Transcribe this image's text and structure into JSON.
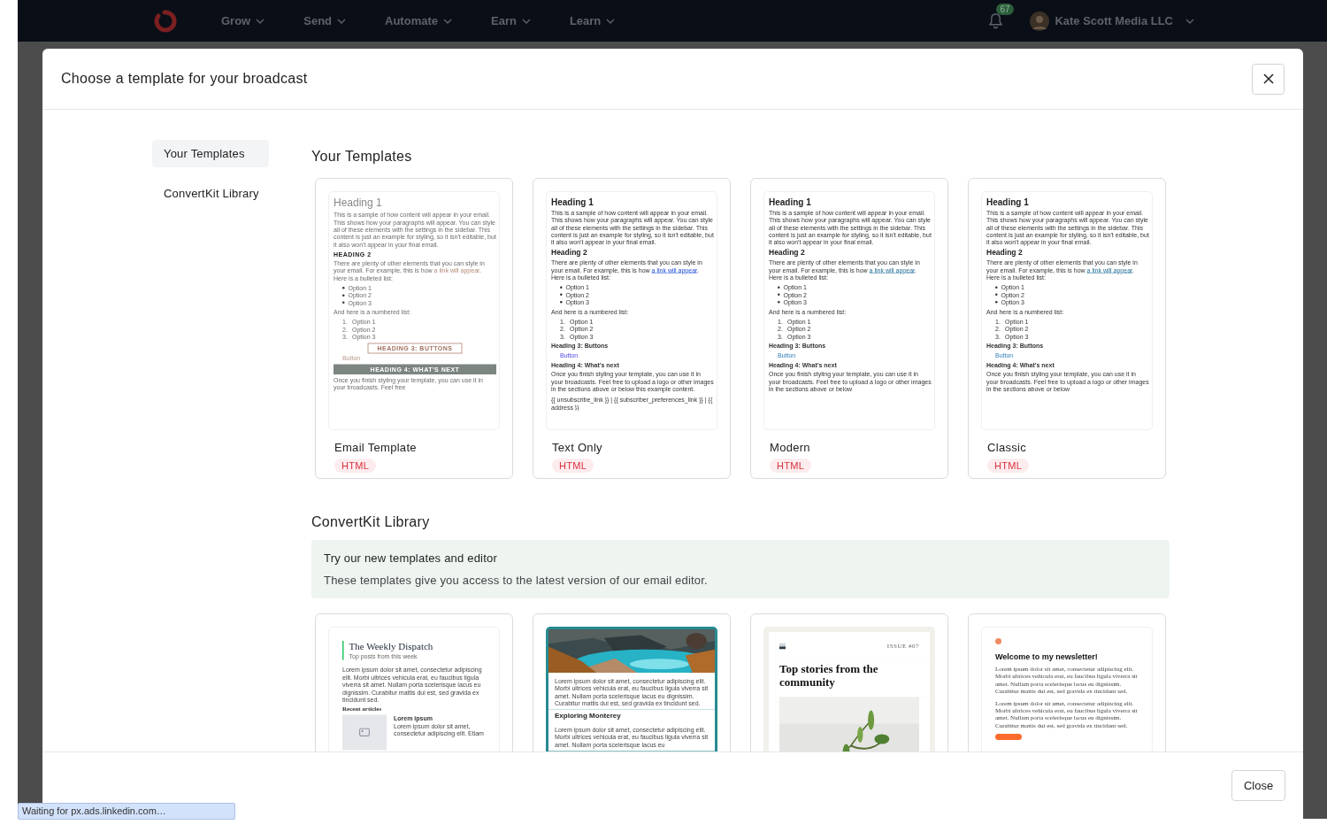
{
  "nav": {
    "items": [
      {
        "label": "Grow"
      },
      {
        "label": "Send"
      },
      {
        "label": "Automate"
      },
      {
        "label": "Earn"
      },
      {
        "label": "Learn"
      }
    ],
    "notifications": {
      "count": "67"
    },
    "account": {
      "name": "Kate Scott Media LLC"
    }
  },
  "modal": {
    "title": "Choose a template for your broadcast",
    "sidebar": {
      "items": [
        {
          "label": "Your Templates",
          "selected": true
        },
        {
          "label": "ConvertKit Library",
          "selected": false
        }
      ]
    },
    "sections": [
      {
        "title": "Your Templates",
        "templates": [
          {
            "name": "Email Template",
            "badge": "HTML",
            "preview": {
              "kind": "email",
              "blocks": [
                {
                  "kind": "h1",
                  "text": "Heading 1"
                },
                {
                  "kind": "p",
                  "text": "This is a sample of how content will appear in your email. This shows how your paragraphs will appear. You can style all of these elements with the settings in the sidebar. This content is just an example for styling, so it isn't editable, but it also won't appear in your final email."
                },
                {
                  "kind": "h2",
                  "text": "HEADING 2"
                },
                {
                  "kind": "p-link",
                  "before": "There are plenty of other elements that you can style in your email. For example, this is how",
                  "link": "a link will appear",
                  "after": ". Here is a bulleted list:"
                },
                {
                  "kind": "ul",
                  "items": [
                    "Option 1",
                    "Option 2",
                    "Option 3"
                  ]
                },
                {
                  "kind": "p",
                  "text": "And here is a numbered list:"
                },
                {
                  "kind": "ol",
                  "items": [
                    {
                      "number": "1.",
                      "text": "Option 1"
                    },
                    {
                      "number": "2.",
                      "text": "Option 2"
                    },
                    {
                      "number": "3.",
                      "text": "Option 3"
                    }
                  ]
                },
                {
                  "kind": "h3",
                  "text": "HEADING 3: BUTTONS"
                },
                {
                  "kind": "button",
                  "text": "Button"
                },
                {
                  "kind": "h4",
                  "text": "HEADING 4: WHAT'S NEXT"
                },
                {
                  "kind": "p",
                  "text": "Once you finish styling your template, you can use it in your broadcasts. Feel free"
                }
              ]
            }
          },
          {
            "name": "Text Only",
            "badge": "HTML",
            "preview": {
              "kind": "text",
              "blocks": [
                {
                  "kind": "h1",
                  "text": "Heading 1"
                },
                {
                  "kind": "p",
                  "text": "This is a sample of how content will appear in your email. This shows how your paragraphs will appear. You can style all of these elements with the settings in the sidebar. This content is just an example for styling, so it isn't editable, but it also won't appear in your final email."
                },
                {
                  "kind": "h2",
                  "text": "Heading 2"
                },
                {
                  "kind": "p-link",
                  "before": "There are plenty of other elements that you can style in your email. For example, this is how",
                  "link": "a link will appear",
                  "after": ". Here is a bulleted list:"
                },
                {
                  "kind": "ul",
                  "items": [
                    "Option 1",
                    "Option 2",
                    "Option 3"
                  ]
                },
                {
                  "kind": "p",
                  "text": "And here is a numbered list:"
                },
                {
                  "kind": "ol",
                  "items": [
                    {
                      "number": "1.",
                      "text": "Option 1"
                    },
                    {
                      "number": "2.",
                      "text": "Option 2"
                    },
                    {
                      "number": "3.",
                      "text": "Option 3"
                    }
                  ]
                },
                {
                  "kind": "h3",
                  "text": "Heading 3: Buttons"
                },
                {
                  "kind": "button",
                  "text": "Button"
                },
                {
                  "kind": "h4",
                  "text": "Heading 4: What's next"
                },
                {
                  "kind": "p",
                  "text": "Once you finish styling your template, you can use it in your broadcasts. Feel free to upload a logo or other images in the sections above or below this example content."
                },
                {
                  "kind": "footer",
                  "text": "{{ unsubscribe_link }} | {{ subscriber_preferences_link }} | {{ address }}"
                }
              ]
            }
          },
          {
            "name": "Modern",
            "badge": "HTML",
            "preview": {
              "kind": "modern",
              "blocks": [
                {
                  "kind": "h1",
                  "text": "Heading 1"
                },
                {
                  "kind": "p",
                  "text": "This is a sample of how content will appear in your email. This shows how your paragraphs will appear. You can style all of these elements with the settings in the sidebar. This content is just an example for styling, so it isn't editable, but it also won't appear in your final email."
                },
                {
                  "kind": "h2",
                  "text": "Heading 2"
                },
                {
                  "kind": "p-link",
                  "before": "There are plenty of other elements that you can style in your email. For example, this is how",
                  "link": "a link will appear",
                  "after": ". Here is a bulleted list:"
                },
                {
                  "kind": "ul",
                  "items": [
                    "Option 1",
                    "Option 2",
                    "Option 3"
                  ]
                },
                {
                  "kind": "p",
                  "text": "And here is a numbered list:"
                },
                {
                  "kind": "ol",
                  "items": [
                    {
                      "number": "1.",
                      "text": "Option 1"
                    },
                    {
                      "number": "2.",
                      "text": "Option 2"
                    },
                    {
                      "number": "3.",
                      "text": "Option 3"
                    }
                  ]
                },
                {
                  "kind": "h3",
                  "text": "Heading 3: Buttons"
                },
                {
                  "kind": "button",
                  "text": "Button"
                },
                {
                  "kind": "h4",
                  "text": "Heading 4: What's next"
                },
                {
                  "kind": "p",
                  "text": "Once you finish styling your template, you can use it in your broadcasts. Feel free to upload a logo or other images in the sections above or below"
                }
              ]
            }
          },
          {
            "name": "Classic",
            "badge": "HTML",
            "preview": {
              "kind": "classic",
              "blocks": [
                {
                  "kind": "h1",
                  "text": "Heading 1"
                },
                {
                  "kind": "p",
                  "text": "This is a sample of how content will appear in your email. This shows how your paragraphs will appear. You can style all of these elements with the settings in the sidebar. This content is just an example for styling, so it isn't editable, but it also won't appear in your final email."
                },
                {
                  "kind": "h2",
                  "text": "Heading 2"
                },
                {
                  "kind": "p-link",
                  "before": "There are plenty of other elements that you can style in your email. For example, this is how",
                  "link": "a link will appear",
                  "after": ". Here is a bulleted list:"
                },
                {
                  "kind": "ul",
                  "items": [
                    "Option 1",
                    "Option 2",
                    "Option 3"
                  ]
                },
                {
                  "kind": "p",
                  "text": "And here is a numbered list:"
                },
                {
                  "kind": "ol",
                  "items": [
                    {
                      "number": "1.",
                      "text": "Option 1"
                    },
                    {
                      "number": "2.",
                      "text": "Option 2"
                    },
                    {
                      "number": "3.",
                      "text": "Option 3"
                    }
                  ]
                },
                {
                  "kind": "h3",
                  "text": "Heading 3: Buttons"
                },
                {
                  "kind": "button",
                  "text": "Button"
                },
                {
                  "kind": "h4",
                  "text": "Heading 4: What's next"
                },
                {
                  "kind": "p",
                  "text": "Once you finish styling your template, you can use it in your broadcasts. Feel free to upload a logo or other images in the sections above or below"
                }
              ]
            }
          }
        ]
      },
      {
        "title": "ConvertKit Library",
        "banner": {
          "title": "Try our new templates and editor",
          "text": "These templates give you access to the latest version of our email editor."
        },
        "templates": [
          {
            "preview": {
              "kind": "dispatch",
              "blocks": [
                {
                  "kind": "masthead",
                  "title": "The Weekly Dispatch",
                  "subtitle": "Top posts from this week"
                },
                {
                  "kind": "p",
                  "text": "Lorem ipsum dolor sit amet, consectetur adipiscing elit. Morbi ultrices vehicula erat, eu faucibus ligula viverra sit amet. Nullam porta scelerisque lacus eu dignissim. Curabitur mattis dui est, sed gravida ex tincidunt sed."
                },
                {
                  "kind": "h5",
                  "text": "Recent articles"
                },
                {
                  "kind": "article",
                  "title": "Lorem ipsum",
                  "text": "Lorem ipsum dolor sit amet, consectetur adipiscing elit. Etiam"
                }
              ]
            }
          },
          {
            "preview": {
              "kind": "monterey",
              "blocks": [
                {
                  "kind": "picture"
                },
                {
                  "kind": "p",
                  "text": "Lorem ipsum dolor sit amet, consectetur adipiscing elit. Morbi ultrices vehicula erat, eu faucibus ligula viverra sit amet. Nullam porta scelerisque lacus eu dignissim. Curabitur mattis dui est, sed gravida ex tincidunt sed."
                },
                {
                  "kind": "h3",
                  "text": "Exploring Monterey"
                },
                {
                  "kind": "p",
                  "text": "Lorem ipsum dolor sit amet, consectetur adipiscing elit. Morbi ultrices vehicula erat, eu faucibus ligula viverra sit amet. Nullam porta scelerisque lacus eu"
                }
              ]
            }
          },
          {
            "preview": {
              "kind": "stories",
              "blocks": [
                {
                  "kind": "issue",
                  "text": "ISSUE #07"
                },
                {
                  "kind": "h1",
                  "text": "Top stories from the community"
                },
                {
                  "kind": "picture"
                }
              ]
            }
          },
          {
            "preview": {
              "kind": "welcome",
              "blocks": [
                {
                  "kind": "dot"
                },
                {
                  "kind": "h1",
                  "text": "Welcome to my newsletter!"
                },
                {
                  "kind": "p",
                  "text": "Lorem ipsum dolor sit amet, consectetur adipiscing elit. Morbi ultrices vehicula erat, eu faucibus ligula viverra sit amet. Nullam porta scelerisque lacus eu dignissim. Curabitur mattis dui est, sed gravida ex tincidunt sed."
                },
                {
                  "kind": "small",
                  "text": "Lorem ipsum dolor sit amet, consectetur adipiscing elit. Morbi ultrices vehicula erat, eu faucibus ligula viverra sit amet. Nullam porta scelerisque lacus eu dignissim. Curabitur mattis dui est, sed gravida ex tincidunt sed."
                },
                {
                  "kind": "cta"
                }
              ]
            }
          }
        ]
      }
    ],
    "footer": {
      "close_button": "Close"
    }
  },
  "status_bar": {
    "text": "Waiting for px.ads.linkedin.com…"
  }
}
